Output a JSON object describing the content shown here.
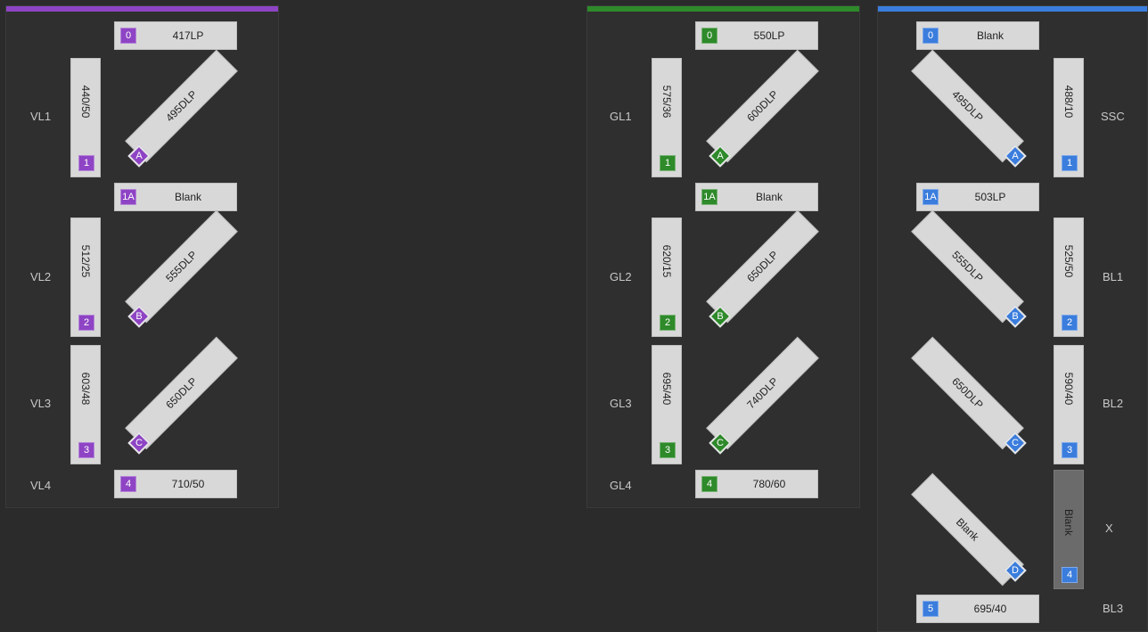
{
  "colors": {
    "violet": "#8e44c4",
    "green": "#2e8a2a",
    "blue": "#3b7ddd",
    "background": "#2b2b2b"
  },
  "violet_panel": {
    "detectors": [
      "VL1",
      "VL2",
      "VL3",
      "VL4"
    ],
    "long_pass": [
      {
        "tag": "0",
        "label": "417LP"
      },
      {
        "tag": "1A",
        "label": "Blank"
      },
      {
        "tag": "4",
        "label": "710/50"
      }
    ],
    "band_pass": [
      {
        "tag": "1",
        "label": "440/50"
      },
      {
        "tag": "2",
        "label": "512/25"
      },
      {
        "tag": "3",
        "label": "603/48"
      }
    ],
    "dichroics": [
      {
        "tag": "A",
        "label": "495DLP"
      },
      {
        "tag": "B",
        "label": "555DLP"
      },
      {
        "tag": "C",
        "label": "650DLP"
      }
    ]
  },
  "green_panel": {
    "detectors": [
      "GL1",
      "GL2",
      "GL3",
      "GL4"
    ],
    "long_pass": [
      {
        "tag": "0",
        "label": "550LP"
      },
      {
        "tag": "1A",
        "label": "Blank"
      },
      {
        "tag": "4",
        "label": "780/60"
      }
    ],
    "band_pass": [
      {
        "tag": "1",
        "label": "575/36"
      },
      {
        "tag": "2",
        "label": "620/15"
      },
      {
        "tag": "3",
        "label": "695/40"
      }
    ],
    "dichroics": [
      {
        "tag": "A",
        "label": "600DLP"
      },
      {
        "tag": "B",
        "label": "650DLP"
      },
      {
        "tag": "C",
        "label": "740DLP"
      }
    ]
  },
  "blue_panel": {
    "detectors": [
      "SSC",
      "BL1",
      "BL2",
      "X",
      "BL3"
    ],
    "long_pass": [
      {
        "tag": "0",
        "label": "Blank"
      },
      {
        "tag": "1A",
        "label": "503LP"
      },
      {
        "tag": "5",
        "label": "695/40"
      }
    ],
    "band_pass": [
      {
        "tag": "1",
        "label": "488/10"
      },
      {
        "tag": "2",
        "label": "525/50"
      },
      {
        "tag": "3",
        "label": "590/40"
      },
      {
        "tag": "4",
        "label": "Blank"
      }
    ],
    "dichroics": [
      {
        "tag": "A",
        "label": "495DLP"
      },
      {
        "tag": "B",
        "label": "555DLP"
      },
      {
        "tag": "C",
        "label": "650DLP"
      },
      {
        "tag": "D",
        "label": "Blank"
      }
    ]
  }
}
